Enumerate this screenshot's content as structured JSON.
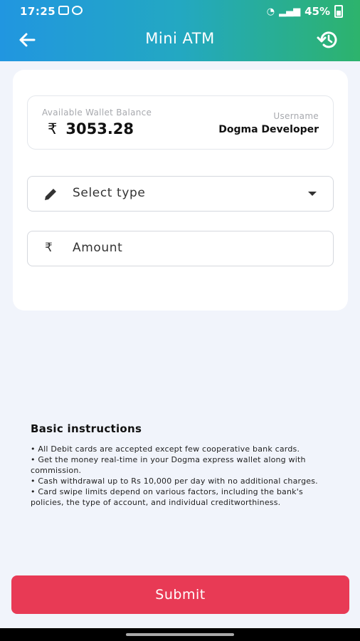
{
  "status_bar": {
    "time": "17:25",
    "battery": "45%"
  },
  "header": {
    "title": "Mini ATM"
  },
  "wallet": {
    "balance_label": "Available Wallet Balance",
    "currency_symbol": "₹",
    "balance": "3053.28",
    "username_label": "Username",
    "username": "Dogma Developer"
  },
  "form": {
    "type_placeholder": "Select type",
    "amount_symbol": "₹",
    "amount_placeholder": "Amount"
  },
  "instructions": {
    "title": "Basic instructions",
    "items": [
      "• All Debit cards are accepted except few cooperative bank cards.",
      "• Get the money real-time in your Dogma express wallet along with commission.",
      "• Cash withdrawal up to Rs 10,000 per day with no additional charges.",
      "• Card swipe limits depend on various factors, including the bank's policies, the type of account, and individual creditworthiness."
    ]
  },
  "actions": {
    "submit_label": "Submit"
  },
  "colors": {
    "accent": "#e83a55",
    "gradient_start": "#2196e0",
    "gradient_end": "#2db36c"
  }
}
